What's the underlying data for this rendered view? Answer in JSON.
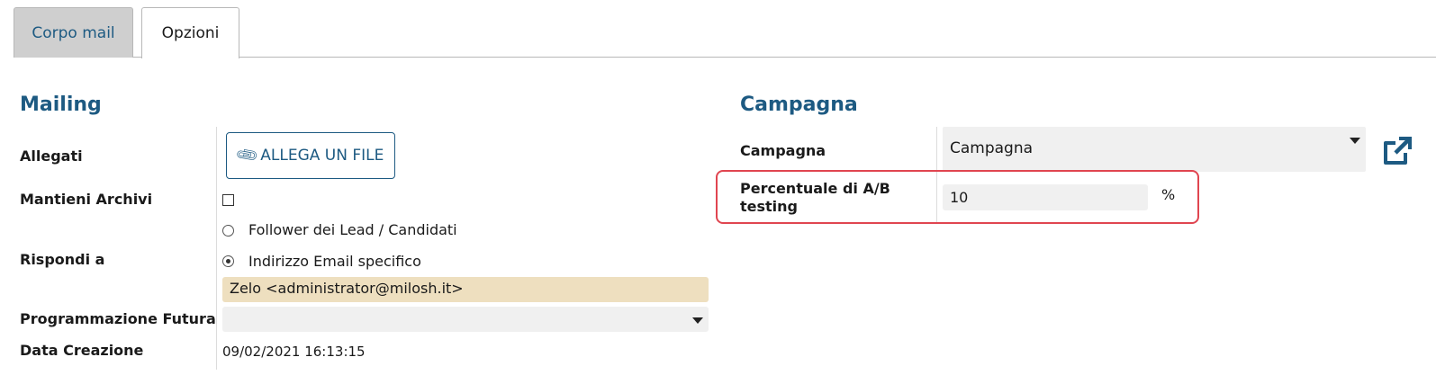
{
  "tabs": [
    {
      "label": "Corpo mail",
      "active": false
    },
    {
      "label": "Opzioni",
      "active": true
    }
  ],
  "mailing": {
    "title": "Mailing",
    "allegati_label": "Allegati",
    "allega_button": "ALLEGA UN FILE",
    "mantieni_label": "Mantieni Archivi",
    "mantieni_checked": false,
    "rispondi_label": "Rispondi a",
    "rispondi_options": [
      {
        "label": "Follower dei Lead / Candidati",
        "selected": false
      },
      {
        "label": "Indirizzo Email specifico",
        "selected": true
      }
    ],
    "email_value": "Zelo <administrator@milosh.it>",
    "programmazione_label": "Programmazione Futura",
    "programmazione_value": "",
    "data_label": "Data Creazione",
    "data_value": "09/02/2021 16:13:15"
  },
  "campagna": {
    "title": "Campagna",
    "campagna_label": "Campagna",
    "campagna_value": "Campagna",
    "ab_label_line1": "Percentuale di A/B",
    "ab_label_line2": "testing",
    "ab_value": "10",
    "ab_unit": "%"
  },
  "icons": {
    "attach": "paperclip-icon",
    "external": "external-link-icon"
  },
  "colors": {
    "accent": "#1d5a82",
    "highlight_border": "#e04550",
    "email_bg": "#eedfbf",
    "field_bg": "#f0f0f0",
    "inactive_tab_bg": "#cfcfcf"
  }
}
